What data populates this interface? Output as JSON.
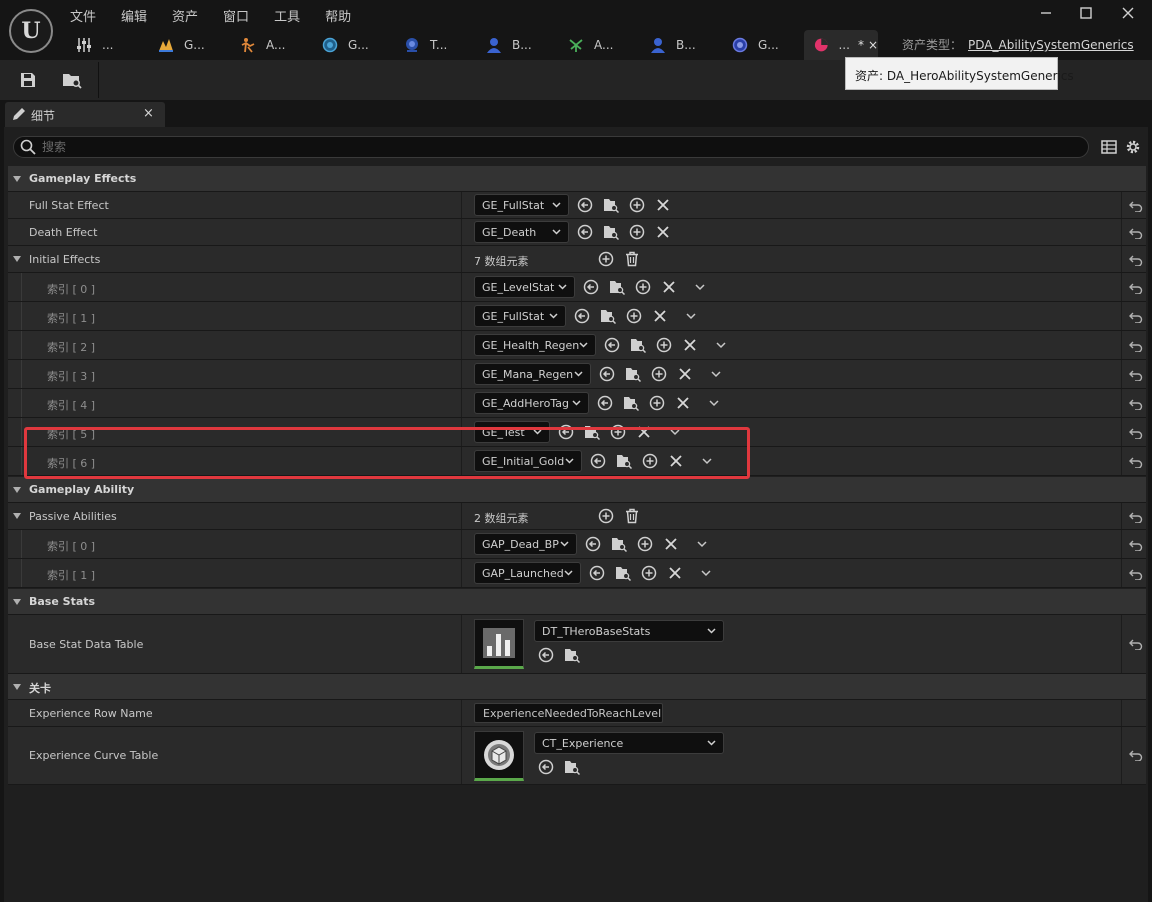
{
  "menu": [
    "文件",
    "编辑",
    "资产",
    "窗口",
    "工具",
    "帮助"
  ],
  "window_controls": [
    "minimize",
    "maximize",
    "close"
  ],
  "tabs": [
    {
      "label": "...",
      "icon": "sliders-icon"
    },
    {
      "label": "G...",
      "icon": "gameplay-tag-icon"
    },
    {
      "label": "A...",
      "icon": "animation-icon"
    },
    {
      "label": "G...",
      "icon": "globe-icon"
    },
    {
      "label": "T...",
      "icon": "blueprint-icon"
    },
    {
      "label": "B...",
      "icon": "character-icon"
    },
    {
      "label": "A...",
      "icon": "animation-graph-icon"
    },
    {
      "label": "B...",
      "icon": "character-icon"
    },
    {
      "label": "G...",
      "icon": "globe-icon"
    },
    {
      "label": "...",
      "icon": "data-asset-icon",
      "dirty": "*",
      "close": "×"
    }
  ],
  "asset_type": {
    "label": "资产类型：",
    "value": "PDA_AbilitySystemGenerics"
  },
  "tooltip": "资产: DA_HeroAbilitySystemGenerics",
  "panel": {
    "title": "细节",
    "close": "×"
  },
  "search": {
    "placeholder": "搜索",
    "value": ""
  },
  "sections": {
    "gameplay_effects": {
      "title": "Gameplay Effects",
      "full_stat": {
        "label": "Full Stat Effect",
        "value": "GE_FullStat"
      },
      "death": {
        "label": "Death Effect",
        "value": "GE_Death"
      },
      "initial": {
        "label": "Initial Effects",
        "count": "7 数组元素",
        "items": [
          {
            "label": "索引 [ 0 ]",
            "value": "GE_LevelStat"
          },
          {
            "label": "索引 [ 1 ]",
            "value": "GE_FullStat"
          },
          {
            "label": "索引 [ 2 ]",
            "value": "GE_Health_Regen"
          },
          {
            "label": "索引 [ 3 ]",
            "value": "GE_Mana_Regen"
          },
          {
            "label": "索引 [ 4 ]",
            "value": "GE_AddHeroTag"
          },
          {
            "label": "索引 [ 5 ]",
            "value": "GE_Test"
          },
          {
            "label": "索引 [ 6 ]",
            "value": "GE_Initial_Gold"
          }
        ]
      }
    },
    "gameplay_ability": {
      "title": "Gameplay Ability",
      "passive": {
        "label": "Passive Abilities",
        "count": "2 数组元素",
        "items": [
          {
            "label": "索引 [ 0 ]",
            "value": "GAP_Dead_BP"
          },
          {
            "label": "索引 [ 1 ]",
            "value": "GAP_Launched"
          }
        ]
      }
    },
    "base_stats": {
      "title": "Base Stats",
      "data_table": {
        "label": "Base Stat Data Table",
        "value": "DT_THeroBaseStats"
      }
    },
    "level": {
      "title": "关卡",
      "row_name": {
        "label": "Experience Row Name",
        "value": "ExperienceNeededToReachLevel"
      },
      "curve_table": {
        "label": "Experience Curve Table",
        "value": "CT_Experience"
      }
    }
  },
  "colors": {
    "highlight": "#e0383e",
    "thumb_underline": "#5aa84a",
    "active_tab_icon": "#e0336a"
  }
}
